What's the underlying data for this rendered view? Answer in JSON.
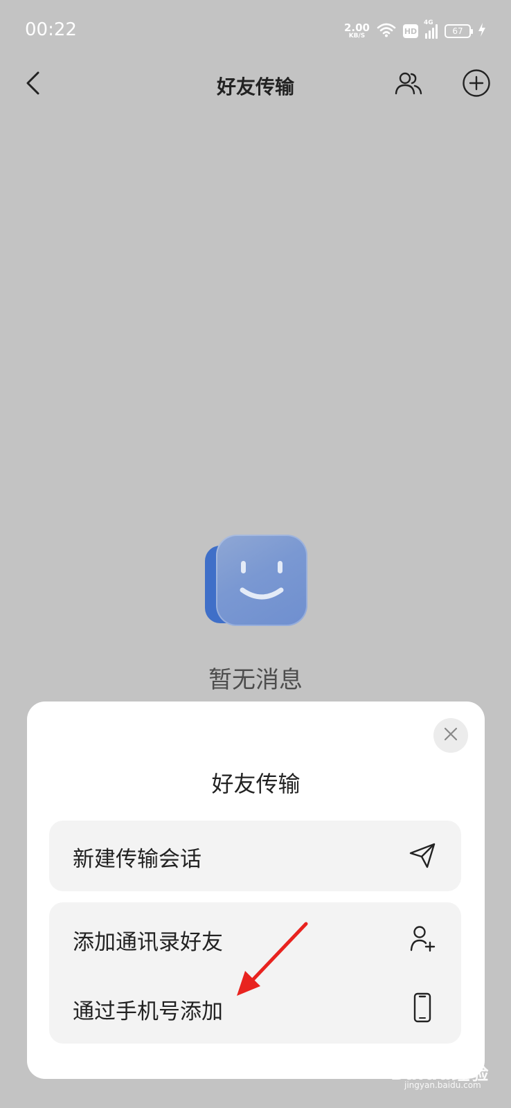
{
  "status_bar": {
    "time": "00:22",
    "net_speed_value": "2.00",
    "net_speed_unit": "KB/S",
    "hd_label": "HD",
    "network_label": "4G",
    "battery_level": "67"
  },
  "header": {
    "title": "好友传输",
    "icons": [
      "back-icon",
      "contacts-icon",
      "add-circle-icon"
    ]
  },
  "empty_state": {
    "text": "暂无消息",
    "illustration": "smiley-face-icon"
  },
  "sheet": {
    "title": "好友传输",
    "close_icon": "close-icon",
    "options": [
      {
        "label": "新建传输会话",
        "icon": "send-icon"
      },
      {
        "label": "添加通讯录好友",
        "icon": "add-user-icon"
      },
      {
        "label": "通过手机号添加",
        "icon": "phone-icon"
      }
    ]
  },
  "annotation": {
    "arrow_color": "#e8231f"
  },
  "watermark": {
    "brand": "Baidu经验",
    "site": "jingyan.baidu.com"
  },
  "colors": {
    "overlay_background": "#c3c3c3",
    "sheet_background": "#ffffff",
    "card_background": "#f3f3f3",
    "illustration_blue": "#3f6fc8"
  }
}
